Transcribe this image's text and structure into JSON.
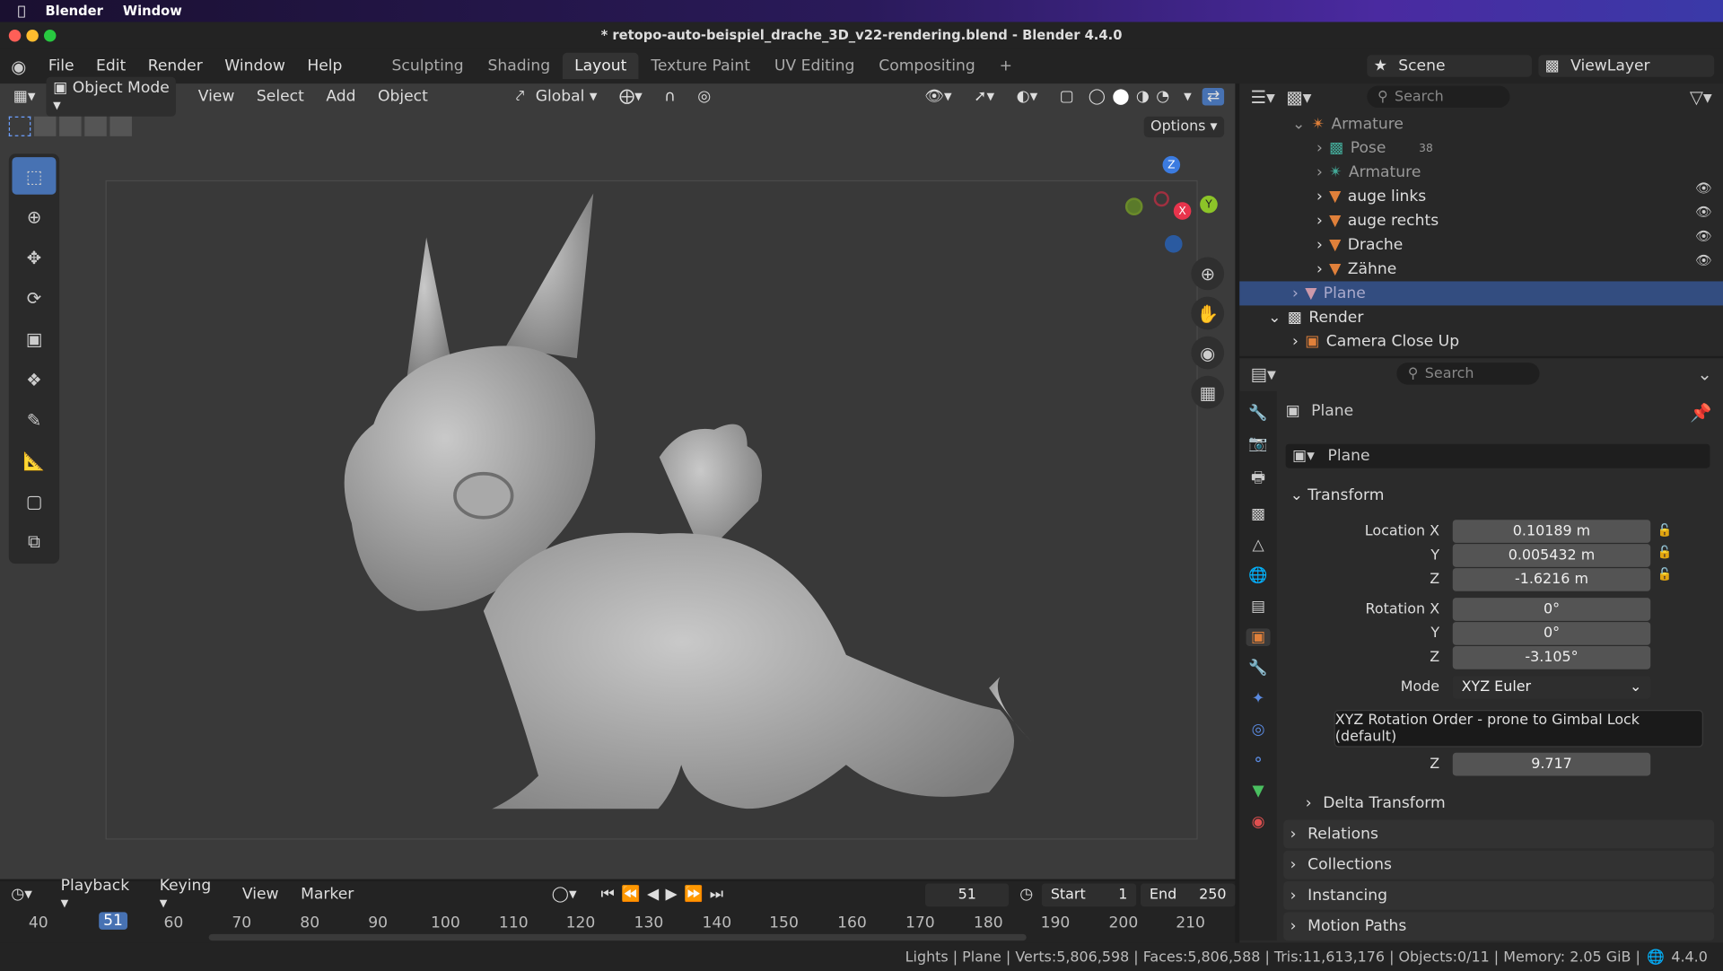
{
  "mac_menu": {
    "app": "Blender",
    "window": "Window"
  },
  "window_title": "* retopo-auto-beispiel_drache_3D_v22-rendering.blend - Blender 4.4.0",
  "menus": [
    "File",
    "Edit",
    "Render",
    "Window",
    "Help"
  ],
  "workspaces": [
    "Sculpting",
    "Shading",
    "Layout",
    "Texture Paint",
    "UV Editing",
    "Compositing"
  ],
  "active_workspace": "Layout",
  "scene": {
    "label": "Scene",
    "view_layer": "ViewLayer"
  },
  "viewport_header": {
    "mode": "Object Mode",
    "menus": [
      "View",
      "Select",
      "Add",
      "Object"
    ],
    "orientation": "Global",
    "options": "Options"
  },
  "gizmo": {
    "z": "Z",
    "y": "Y",
    "x": "X"
  },
  "outliner": {
    "search_placeholder": "Search",
    "rows": [
      {
        "label": "Armature",
        "level": 1
      },
      {
        "label": "Pose",
        "level": 2,
        "badge": "38"
      },
      {
        "label": "Armature",
        "level": 2
      },
      {
        "label": "auge links",
        "level": 2
      },
      {
        "label": "auge rechts",
        "level": 2
      },
      {
        "label": "Drache",
        "level": 2
      },
      {
        "label": "Zähne",
        "level": 2
      },
      {
        "label": "Plane",
        "level": 1,
        "selected": true
      },
      {
        "label": "Render",
        "level": 0
      },
      {
        "label": "Camera Close Up",
        "level": 1
      }
    ]
  },
  "properties": {
    "search_placeholder": "Search",
    "object_name": "Plane",
    "data_name": "Plane",
    "transform_title": "Transform",
    "location": {
      "label": "Location X",
      "x": "0.10189 m",
      "y": "0.005432 m",
      "z": "-1.6216 m"
    },
    "rotation": {
      "label": "Rotation X",
      "x": "0°",
      "y": "0°",
      "z": "-3.105°"
    },
    "mode_label": "Mode",
    "mode_value": "XYZ Euler",
    "tooltip": "XYZ Rotation Order - prone to Gimbal Lock (default)",
    "scale_z": "9.717",
    "axis_y": "Y",
    "axis_z": "Z",
    "sections": [
      "Delta Transform",
      "Relations",
      "Collections",
      "Instancing",
      "Motion Paths"
    ]
  },
  "timeline": {
    "menus": [
      "Playback",
      "Keying",
      "View",
      "Marker"
    ],
    "current_frame": "51",
    "start_label": "Start",
    "start": "1",
    "end_label": "End",
    "end": "250",
    "ticks": [
      "40",
      "51",
      "60",
      "70",
      "80",
      "90",
      "100",
      "110",
      "120",
      "130",
      "140",
      "150",
      "160",
      "170",
      "180",
      "190",
      "200",
      "210"
    ]
  },
  "status_bar": "Lights | Plane | Verts:5,806,598 | Faces:5,806,588 | Tris:11,613,176 | Objects:0/11 | Memory: 2.05 GiB | ",
  "version": "4.4.0",
  "colors": {
    "accent": "#4772b3",
    "selected_row": "#334d80",
    "gizmo_x": "#e8344c",
    "gizmo_y": "#8cc428",
    "gizmo_z": "#3b7be0"
  }
}
